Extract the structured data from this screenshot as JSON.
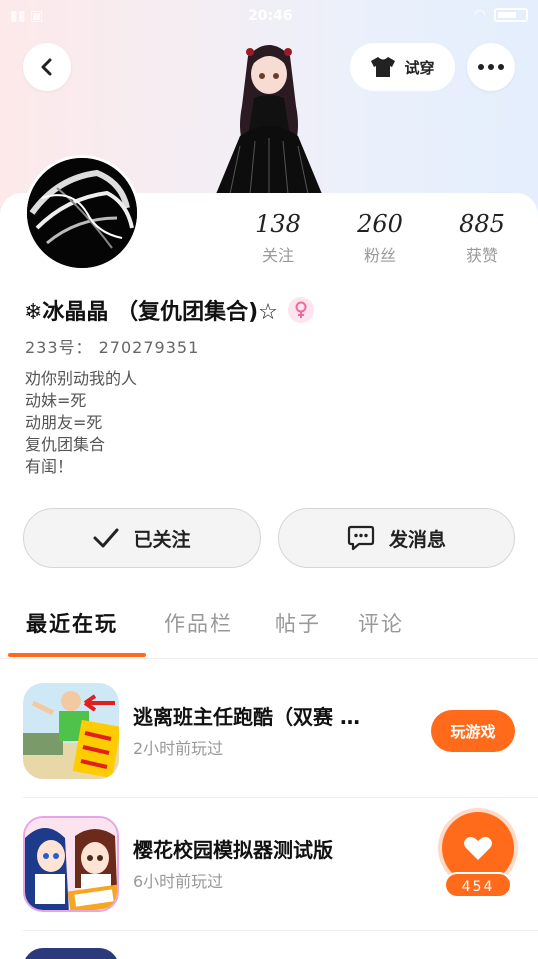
{
  "status_bar": {
    "time": "20:46"
  },
  "header": {
    "try_on_label": "试穿"
  },
  "stats": [
    {
      "value": "138",
      "label": "关注"
    },
    {
      "value": "260",
      "label": "粉丝"
    },
    {
      "value": "885",
      "label": "获赞"
    }
  ],
  "profile": {
    "nickname": "❄冰晶晶 （复仇团集合)☆",
    "uid": "233号： 270279351",
    "bio": [
      "劝你别动我的人",
      "动妹=死",
      "动朋友=死",
      "复仇团集合",
      "有闺！"
    ]
  },
  "actions": {
    "follow_label": "已关注",
    "message_label": "发消息"
  },
  "tabs": [
    "最近在玩",
    "作品栏",
    "帖子",
    "评论"
  ],
  "games": [
    {
      "title": "逃离班主任跑酷（双赛 …",
      "subtitle": "2小时前玩过",
      "button": "玩游戏"
    },
    {
      "title": "樱花校园模拟器测试版",
      "subtitle": "6小时前玩过"
    }
  ],
  "like": {
    "count": "454"
  },
  "colors": {
    "accent": "#ff6b1a"
  }
}
